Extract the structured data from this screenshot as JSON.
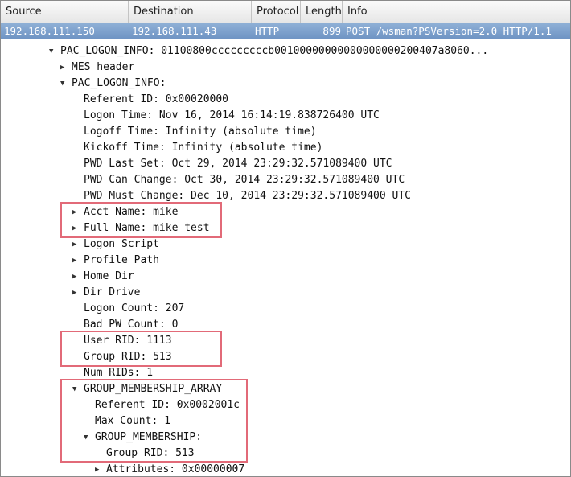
{
  "columns": {
    "source": "Source",
    "destination": "Destination",
    "protocol": "Protocol",
    "length": "Length",
    "info": "Info"
  },
  "packet": {
    "source": "192.168.111.150",
    "destination": "192.168.111.43",
    "protocol": "HTTP",
    "length": "899",
    "info": "POST /wsman?PSVersion=2.0 HTTP/1.1"
  },
  "tree": [
    {
      "text": "PAC_LOGON_INFO: 01100800cccccccccb00100000000000000000200407a8060...",
      "arrow": "expanded"
    },
    {
      "text": "MES header",
      "arrow": "collapsed"
    },
    {
      "text": "PAC_LOGON_INFO:",
      "arrow": "expanded"
    },
    {
      "text": "Referent ID: 0x00020000",
      "arrow": "none"
    },
    {
      "text": "Logon Time: Nov 16, 2014 16:14:19.838726400 UTC",
      "arrow": "none"
    },
    {
      "text": "Logoff Time: Infinity (absolute time)",
      "arrow": "none"
    },
    {
      "text": "Kickoff Time: Infinity (absolute time)",
      "arrow": "none"
    },
    {
      "text": "PWD Last Set: Oct 29, 2014 23:29:32.571089400 UTC",
      "arrow": "none"
    },
    {
      "text": "PWD Can Change: Oct 30, 2014 23:29:32.571089400 UTC",
      "arrow": "none"
    },
    {
      "text": "PWD Must Change: Dec 10, 2014 23:29:32.571089400 UTC",
      "arrow": "none"
    },
    {
      "text": "Acct Name: mike",
      "arrow": "collapsed"
    },
    {
      "text": "Full Name: mike test",
      "arrow": "collapsed"
    },
    {
      "text": "Logon Script",
      "arrow": "collapsed"
    },
    {
      "text": "Profile Path",
      "arrow": "collapsed"
    },
    {
      "text": "Home Dir",
      "arrow": "collapsed"
    },
    {
      "text": "Dir Drive",
      "arrow": "collapsed"
    },
    {
      "text": "Logon Count: 207",
      "arrow": "none"
    },
    {
      "text": "Bad PW Count: 0",
      "arrow": "none"
    },
    {
      "text": "User RID: 1113",
      "arrow": "none"
    },
    {
      "text": "Group RID: 513",
      "arrow": "none"
    },
    {
      "text": "Num RIDs: 1",
      "arrow": "none"
    },
    {
      "text": "GROUP_MEMBERSHIP_ARRAY",
      "arrow": "expanded"
    },
    {
      "text": "Referent ID: 0x0002001c",
      "arrow": "none"
    },
    {
      "text": "Max Count: 1",
      "arrow": "none"
    },
    {
      "text": "GROUP_MEMBERSHIP:",
      "arrow": "expanded"
    },
    {
      "text": "Group RID: 513",
      "arrow": "none"
    },
    {
      "text": "Attributes: 0x00000007",
      "arrow": "collapsed"
    }
  ],
  "colors": {
    "selected_row": "#7a9ccb",
    "highlight_box": "#e26a78"
  }
}
